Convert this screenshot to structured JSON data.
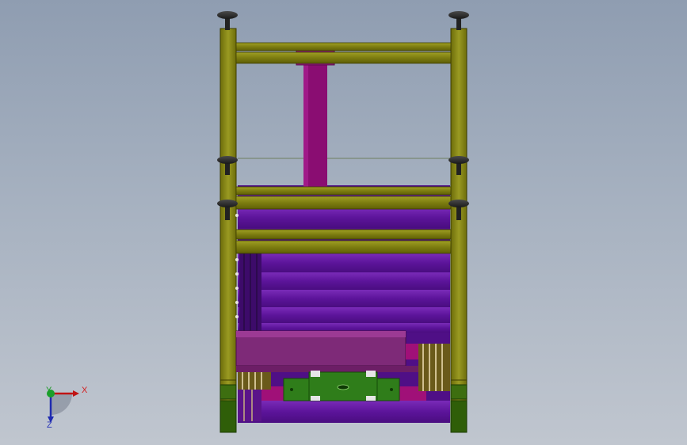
{
  "colors": {
    "frame": "#8a8a12",
    "frame_dark": "#5a5a05",
    "frame_light": "#a3a327",
    "magenta": "#8c0f74",
    "purple": "#6a1aa0",
    "purple_light": "#8a3ac8",
    "pink_plate": "#7e2a78",
    "green_plate": "#2f7d1a",
    "foot": "#2c2c2c",
    "pulley": "#b0a070"
  },
  "triad": {
    "x_label": "X",
    "y_label": "Y",
    "z_label": "Z"
  }
}
